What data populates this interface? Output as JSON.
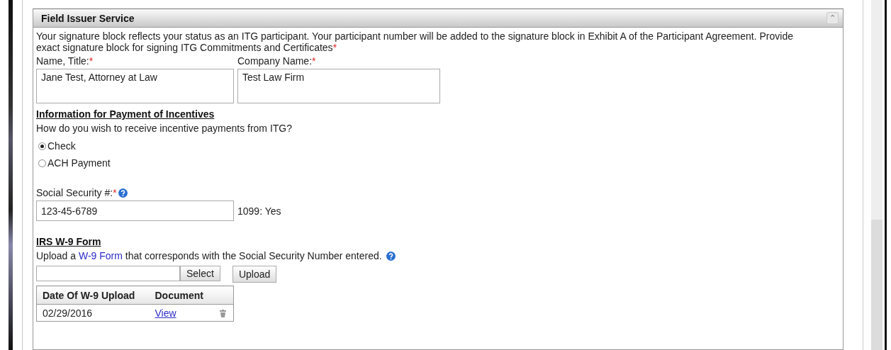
{
  "panel": {
    "title": "Field Issuer Service",
    "collapse_icon": "⌃"
  },
  "intro": {
    "text": "Your signature block reflects your status as an ITG participant. Your participant number will be added to the signature block in Exhibit A of the Participant Agreement. Provide exact signature block for signing ITG Commitments and Certificates",
    "required_mark": "*"
  },
  "signature_fields": [
    {
      "label": "Name, Title:",
      "required_mark": "*",
      "value": "Jane Test, Attorney at Law"
    },
    {
      "label": "Company Name:",
      "required_mark": "*",
      "value": "Test Law Firm"
    }
  ],
  "payment": {
    "heading": "Information for Payment of Incentives",
    "question": "How do you wish to receive incentive payments from ITG?",
    "options": [
      {
        "label": "Check",
        "selected": true
      },
      {
        "label": "ACH Payment",
        "selected": false
      }
    ]
  },
  "ssn": {
    "label": "Social Security #:",
    "required_mark": "*",
    "value": "123-45-6789",
    "note": "1099: Yes"
  },
  "w9": {
    "heading": "IRS W-9 Form",
    "before": "Upload a ",
    "link": "W-9 Form",
    "after": " that corresponds with the Social Security Number entered.",
    "select_button": "Select",
    "upload_button": "Upload",
    "columns": [
      "Date Of W-9 Upload",
      "Document"
    ],
    "rows": [
      {
        "date": "02/29/2016",
        "link": "View"
      }
    ]
  }
}
